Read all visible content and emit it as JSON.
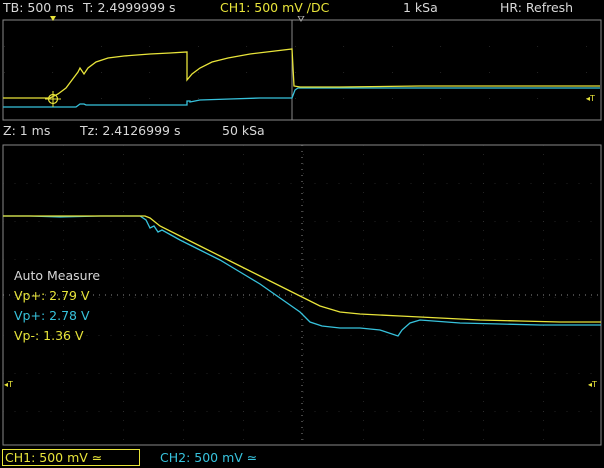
{
  "status_bar": {
    "timebase": "TB: 500 ms",
    "trigger_time": "T: 2.4999999 s",
    "ch1_setting": "CH1: 500 mV /DC",
    "sample_rate": "1 kSa",
    "hr_mode": "HR: Refresh"
  },
  "zoom_bar": {
    "zoom": "Z: 1 ms",
    "zoom_time": "Tz: 2.4126999 s",
    "sample_rate": "50 kSa"
  },
  "measure": {
    "title": "Auto Measure",
    "items": [
      {
        "label": "Vp+: 2.79 V",
        "color": "#e8e43a"
      },
      {
        "label": "Vp+: 2.78 V",
        "color": "#37c2dc"
      },
      {
        "label": "Vp-: 1.36 V",
        "color": "#e8e43a"
      }
    ]
  },
  "channels": {
    "ch1": {
      "label": "CH1: 500 mV ≃",
      "color": "#e8e43a"
    },
    "ch2": {
      "label": "CH2: 500 mV ≃",
      "color": "#37c2dc"
    }
  },
  "trigger_markers": {
    "left": "◂T",
    "right": "◂T"
  },
  "colors": {
    "ch1": "#e8e43a",
    "ch2": "#37c2dc",
    "grid": "#7a7a7a",
    "text": "#d8d8d8"
  }
}
